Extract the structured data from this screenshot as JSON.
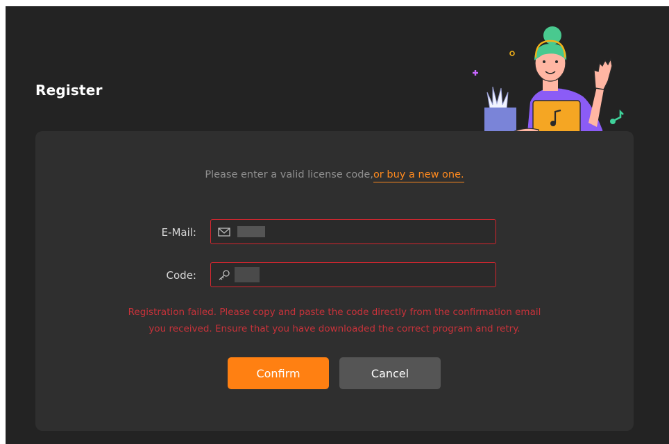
{
  "dialog": {
    "title": "Register"
  },
  "hint": {
    "text": "Please enter a valid license code,",
    "link_label": "or buy a new one."
  },
  "email": {
    "label": "E-Mail:",
    "value": "",
    "icon": "envelope-icon"
  },
  "code": {
    "label": "Code:",
    "value": "",
    "icon": "key-icon"
  },
  "error": {
    "line1": "Registration failed. Please copy and paste the code directly from the confirmation email",
    "line2": "you received. Ensure that you have downloaded the correct program and retry."
  },
  "buttons": {
    "confirm_label": "Confirm",
    "cancel_label": "Cancel"
  },
  "colors": {
    "accent": "#ff8012",
    "error": "#c8323a",
    "field_border_error": "#d9262f",
    "background": "#232323",
    "card": "#2f2f2f"
  }
}
